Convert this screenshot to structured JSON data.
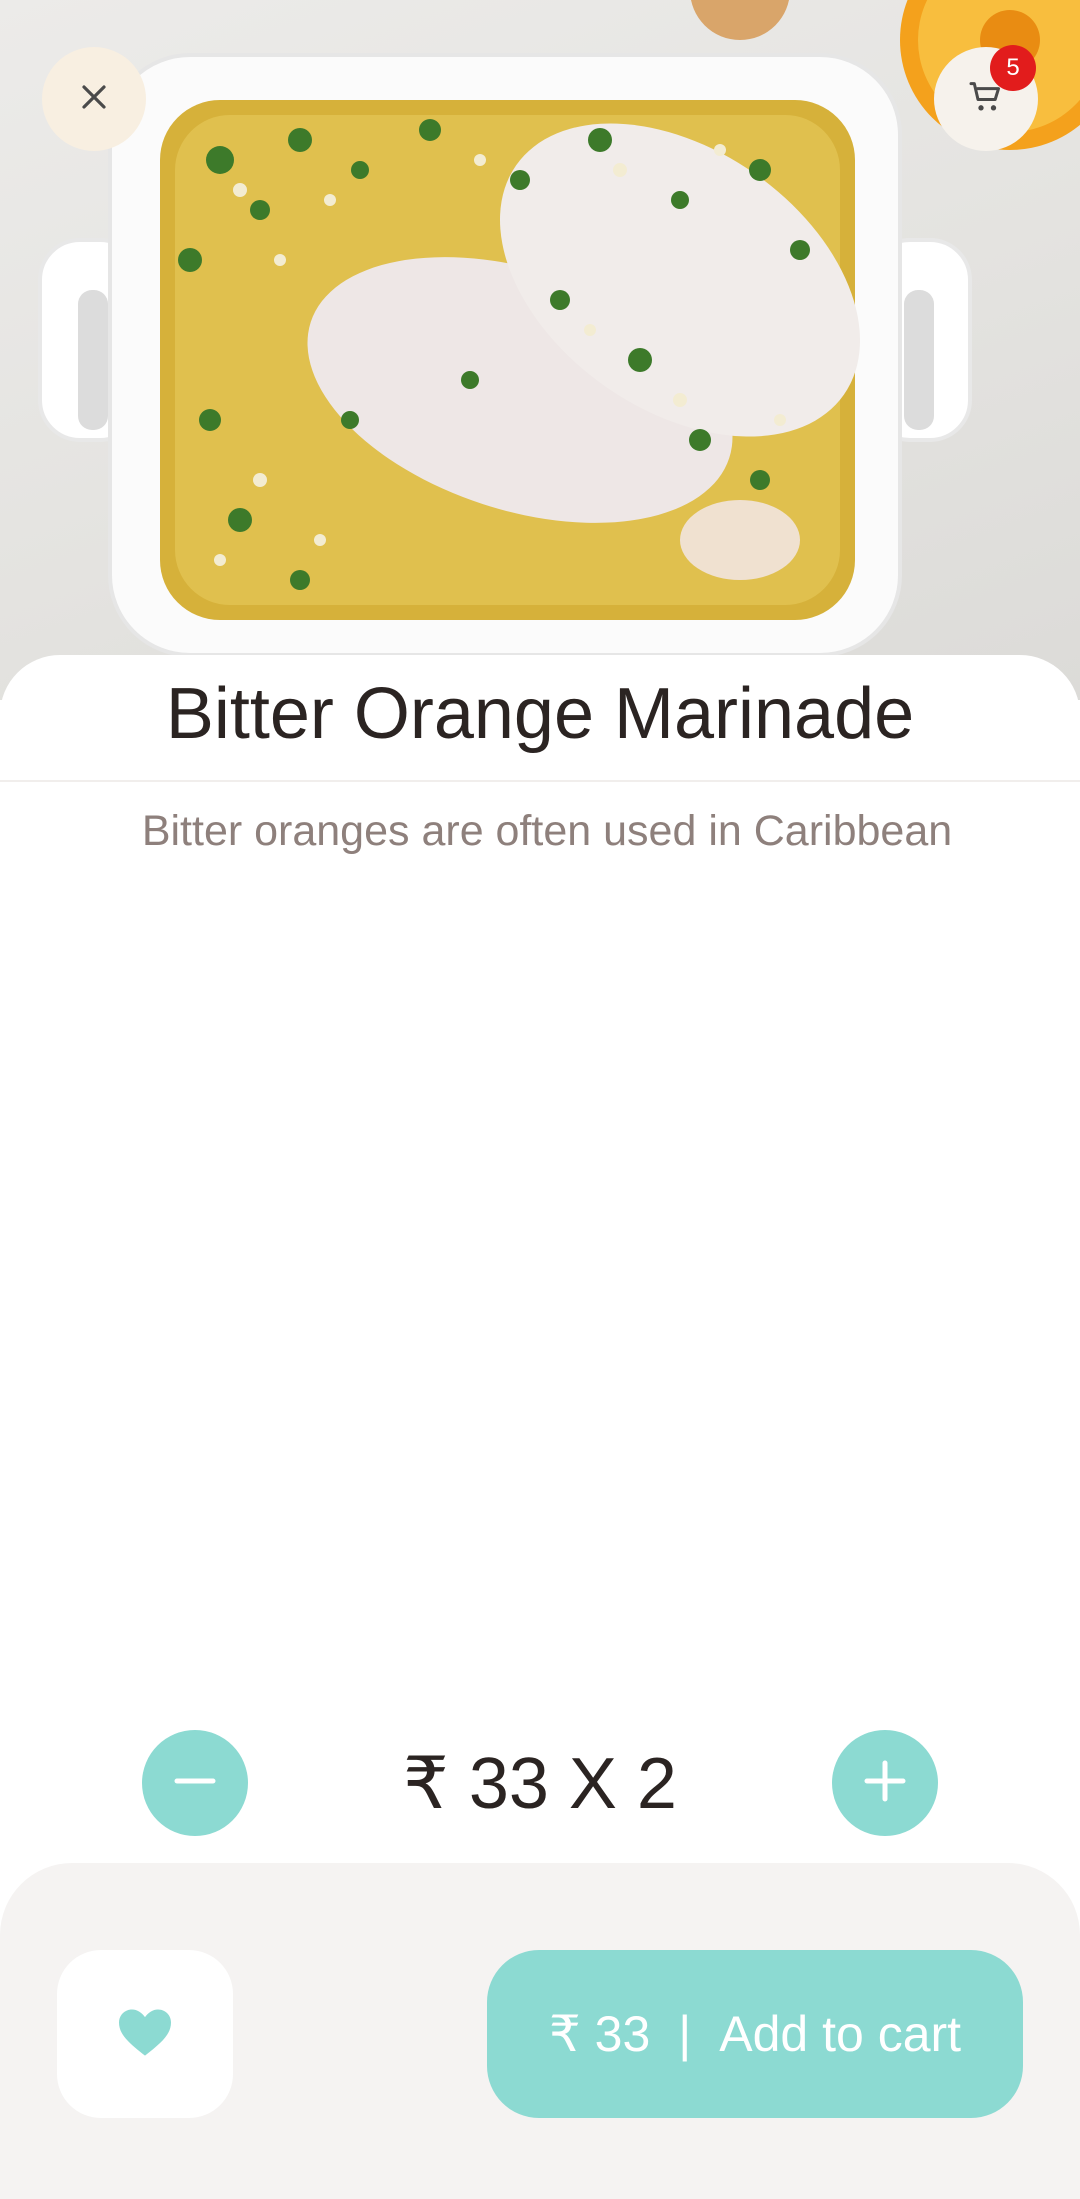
{
  "header": {
    "close_icon": "close-icon",
    "cart_icon": "cart-icon",
    "cart_badge": "5"
  },
  "product": {
    "title": "Bitter Orange Marinade",
    "description": "Bitter oranges are often used in Caribbean"
  },
  "quantity": {
    "display": "₹ 33 X 2",
    "minus_icon": "minus-icon",
    "plus_icon": "plus-icon"
  },
  "bottom_bar": {
    "favorite_icon": "heart-icon",
    "price": "₹ 33",
    "separator": "|",
    "add_label": "Add to cart"
  },
  "colors": {
    "accent": "#8cdad2",
    "badge": "#e21c1c",
    "title_text": "#2b2422",
    "description_text": "#8e807c"
  }
}
